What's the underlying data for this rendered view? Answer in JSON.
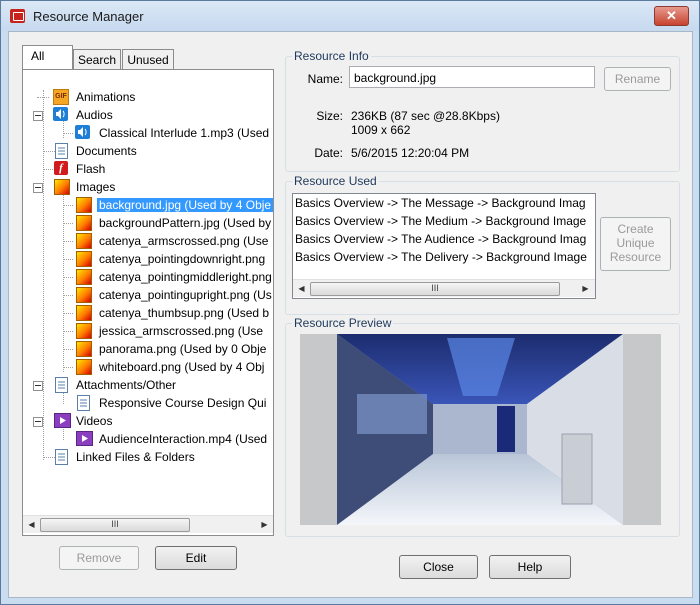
{
  "window": {
    "title": "Resource Manager",
    "close_glyph": "✕"
  },
  "tabs": [
    {
      "label": "All",
      "active": true
    },
    {
      "label": "Search",
      "active": false
    },
    {
      "label": "Unused",
      "active": false
    }
  ],
  "tree": {
    "animations": {
      "label": "Animations",
      "icon": "gif-icon",
      "badge": "GIF"
    },
    "audios": {
      "label": "Audios",
      "icon": "speaker-icon",
      "children": [
        "Classical Interlude 1.mp3 (Used"
      ]
    },
    "documents": {
      "label": "Documents",
      "icon": "document-icon"
    },
    "flash": {
      "label": "Flash",
      "icon": "flash-icon"
    },
    "images": {
      "label": "Images",
      "icon": "image-icon",
      "children": [
        "background.jpg (Used by 4 Obje",
        "backgroundPattern.jpg (Used by",
        "catenya_armscrossed.png (Use",
        "catenya_pointingdownright.png",
        "catenya_pointingmiddleright.png",
        "catenya_pointingupright.png (Us",
        "catenya_thumbsup.png (Used b",
        "jessica_armscrossed.png (Use",
        "panorama.png (Used by 0 Obje",
        "whiteboard.png (Used by 4 Obj"
      ],
      "selected_index": 0
    },
    "attachments": {
      "label": "Attachments/Other",
      "icon": "attachment-icon",
      "children": [
        "Responsive Course Design Qui"
      ]
    },
    "videos": {
      "label": "Videos",
      "icon": "video-icon",
      "children": [
        "AudienceInteraction.mp4 (Used"
      ]
    },
    "linked": {
      "label": "Linked Files & Folders",
      "icon": "linked-files-icon"
    }
  },
  "left_buttons": {
    "remove": "Remove",
    "edit": "Edit"
  },
  "resource_info": {
    "group_title": "Resource Info",
    "name_label": "Name:",
    "name_value": "background.jpg",
    "rename": "Rename",
    "size_label": "Size:",
    "size_value": "236KB (87 sec @28.8Kbps)",
    "dimensions": "1009 x 662",
    "date_label": "Date:",
    "date_value": "5/6/2015 12:20:04 PM"
  },
  "resource_used": {
    "group_title": "Resource Used",
    "items": [
      "Basics Overview -> The Message -> Background Imag",
      "Basics Overview -> The Medium -> Background Image",
      "Basics Overview -> The Audience -> Background Imag",
      "Basics Overview -> The Delivery -> Background Image"
    ],
    "create_unique_line1": "Create",
    "create_unique_line2": "Unique",
    "create_unique_line3": "Resource"
  },
  "resource_preview": {
    "group_title": "Resource Preview"
  },
  "scrollbar": {
    "left_arrow": "◀",
    "right_arrow": "▶",
    "grip": "III"
  },
  "bottom_buttons": {
    "close": "Close",
    "help": "Help"
  }
}
